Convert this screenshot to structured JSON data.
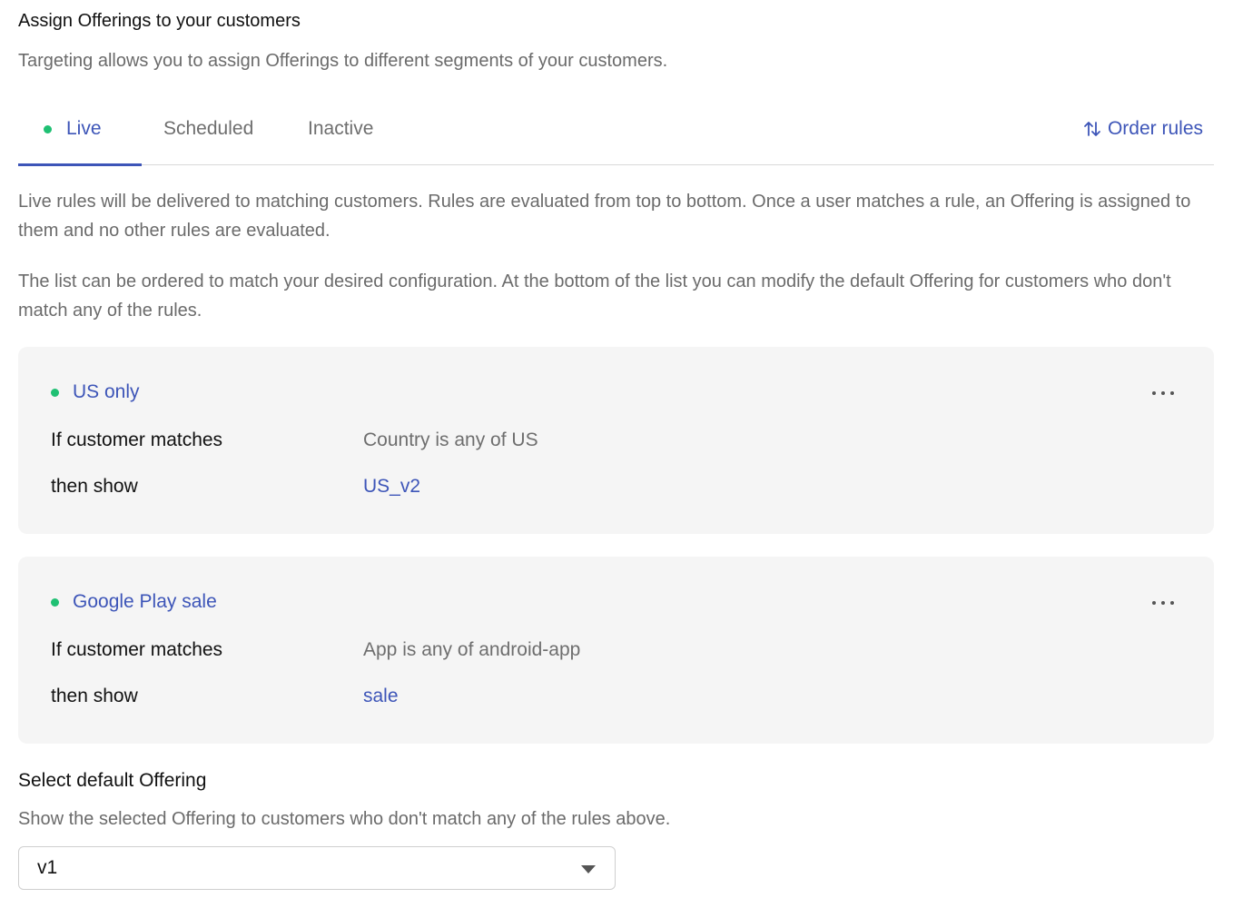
{
  "header": {
    "title": "Assign Offerings to your customers",
    "subtitle": "Targeting allows you to assign Offerings to different segments of your customers."
  },
  "tabs": [
    {
      "label": "Live",
      "active": true,
      "status_color": "#1fc073"
    },
    {
      "label": "Scheduled",
      "active": false
    },
    {
      "label": "Inactive",
      "active": false
    }
  ],
  "order_rules": {
    "label": "Order rules",
    "icon": "sort-arrows-icon"
  },
  "description": {
    "paragraph1": "Live rules will be delivered to matching customers. Rules are evaluated from top to bottom. Once a user matches a rule, an Offering is assigned to them and no other rules are evaluated.",
    "paragraph2": "The list can be ordered to match your desired configuration. At the bottom of the list you can modify the default Offering for customers who don't match any of the rules."
  },
  "rules": [
    {
      "name": "US only",
      "condition_label": "If customer matches",
      "condition": "Country is any of US",
      "action_label": "then show",
      "offering": "US_v2"
    },
    {
      "name": "Google Play sale",
      "condition_label": "If customer matches",
      "condition": "App is any of android-app",
      "action_label": "then show",
      "offering": "sale"
    }
  ],
  "default_offering": {
    "title": "Select default Offering",
    "description": "Show the selected Offering to customers who don't match any of the rules above.",
    "selected": "v1"
  },
  "colors": {
    "accent": "#3d55b8",
    "live_dot": "#1fc073",
    "card_background": "#f5f5f5"
  }
}
